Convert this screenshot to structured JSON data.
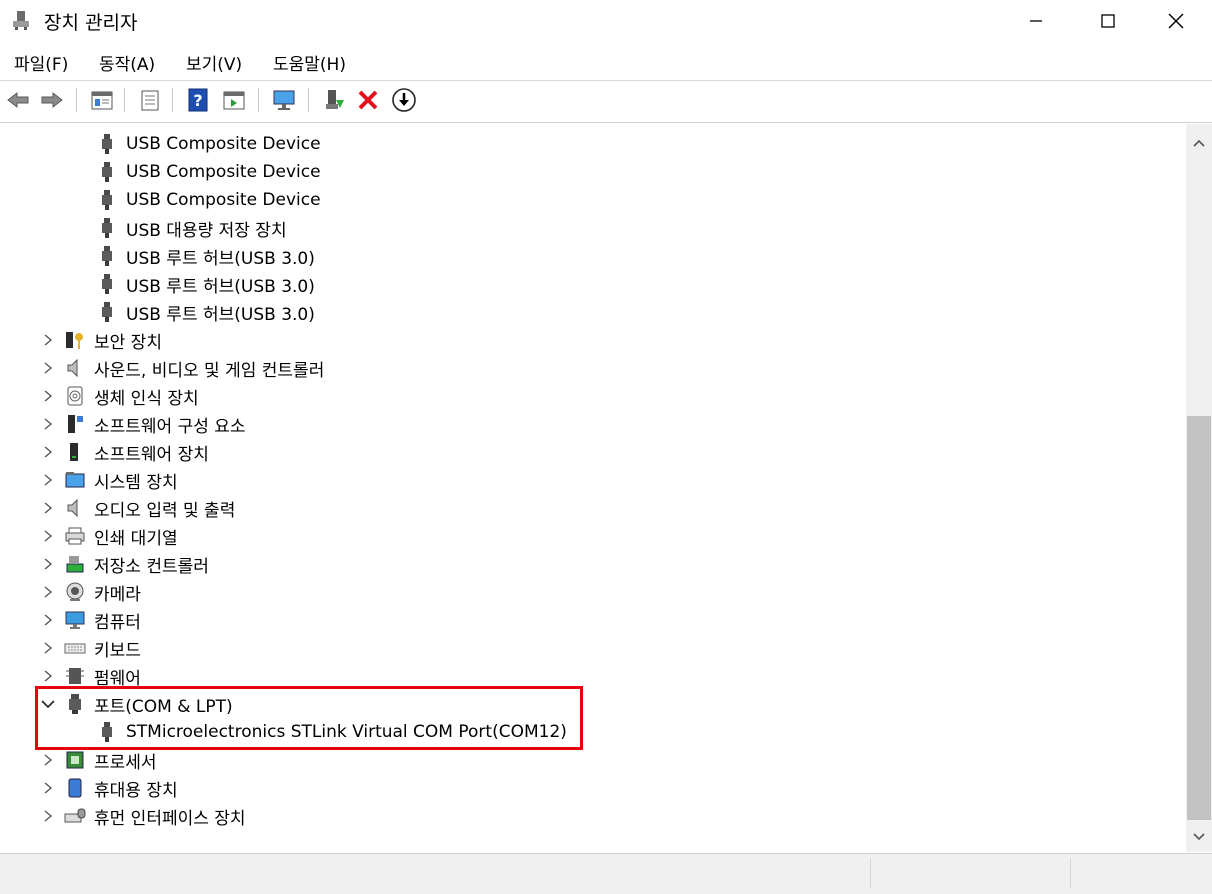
{
  "window": {
    "title": "장치 관리자"
  },
  "menu": {
    "items": [
      "파일(F)",
      "동작(A)",
      "보기(V)",
      "도움말(H)"
    ]
  },
  "toolbar": {
    "buttons": [
      "back-icon",
      "forward-icon",
      "properties-panel-icon",
      "list-view-icon",
      "help-icon",
      "action-pane-icon",
      "monitor-scan-icon",
      "enable-device-icon",
      "uninstall-icon",
      "update-driver-icon"
    ]
  },
  "tree": {
    "usb_children": [
      "USB Composite Device",
      "USB Composite Device",
      "USB Composite Device",
      "USB 대용량 저장 장치",
      "USB 루트 허브(USB 3.0)",
      "USB 루트 허브(USB 3.0)",
      "USB 루트 허브(USB 3.0)"
    ],
    "categories_before": [
      {
        "label": "보안 장치",
        "icon": "security-key-icon"
      },
      {
        "label": "사운드, 비디오 및 게임 컨트롤러",
        "icon": "speaker-icon"
      },
      {
        "label": "생체 인식 장치",
        "icon": "fingerprint-icon"
      },
      {
        "label": "소프트웨어 구성 요소",
        "icon": "software-component-icon"
      },
      {
        "label": "소프트웨어 장치",
        "icon": "software-device-icon"
      },
      {
        "label": "시스템 장치",
        "icon": "system-folder-icon"
      },
      {
        "label": "오디오 입력 및 출력",
        "icon": "speaker-icon"
      },
      {
        "label": "인쇄 대기열",
        "icon": "printer-icon"
      },
      {
        "label": "저장소 컨트롤러",
        "icon": "storage-controller-icon"
      },
      {
        "label": "카메라",
        "icon": "camera-icon"
      },
      {
        "label": "컴퓨터",
        "icon": "monitor-icon"
      },
      {
        "label": "키보드",
        "icon": "keyboard-icon"
      },
      {
        "label": "펌웨어",
        "icon": "firmware-chip-icon"
      }
    ],
    "ports": {
      "label": "포트(COM & LPT)",
      "child": "STMicroelectronics STLink Virtual COM Port(COM12)"
    },
    "categories_after": [
      {
        "label": "프로세서",
        "icon": "processor-icon"
      },
      {
        "label": "휴대용 장치",
        "icon": "portable-device-icon"
      },
      {
        "label": "휴먼 인터페이스 장치",
        "icon": "hid-icon"
      }
    ]
  },
  "colors": {
    "highlight": "#e8000d",
    "accent_blue": "#1e73d2"
  }
}
